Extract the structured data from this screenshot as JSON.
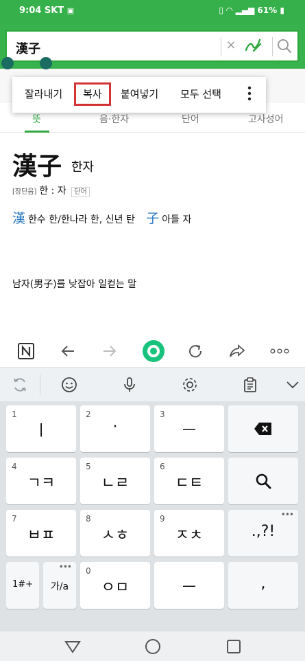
{
  "status": {
    "time": "9:04",
    "carrier": "SKT",
    "battery": "61%"
  },
  "search": {
    "value": "漢子",
    "clear_glyph": "×"
  },
  "context_menu": {
    "items": [
      "잘라내기",
      "복사",
      "붙여넣기",
      "모두 선택"
    ]
  },
  "tabs": [
    "뜻",
    "음·한자",
    "단어",
    "고사성어"
  ],
  "entry": {
    "headword": "漢子",
    "reading": "한자",
    "length_tag": "[장단음]",
    "syllables": "한 : 자",
    "type_tag": "단어",
    "char1": {
      "hanja": "漢",
      "meaning": "한수 한/한나라 한, 신년 탄"
    },
    "char2": {
      "hanja": "子",
      "meaning": "아들 자"
    },
    "definition": "남자(男子)를 낮잡아 일컫는 말"
  },
  "keyboard": {
    "rows": [
      [
        {
          "num": "1",
          "label": "ㅣ"
        },
        {
          "num": "2",
          "label": "·"
        },
        {
          "num": "3",
          "label": "ㅡ"
        },
        {
          "num": "",
          "label": ""
        }
      ],
      [
        {
          "num": "4",
          "label": "ㄱㅋ"
        },
        {
          "num": "5",
          "label": "ㄴㄹ"
        },
        {
          "num": "6",
          "label": "ㄷㅌ"
        },
        {
          "num": "",
          "label": ""
        }
      ],
      [
        {
          "num": "7",
          "label": "ㅂㅍ"
        },
        {
          "num": "8",
          "label": "ㅅㅎ"
        },
        {
          "num": "9",
          "label": "ㅈㅊ"
        },
        {
          "num": "",
          "label": ".,?!"
        }
      ],
      [
        {
          "num": "",
          "label": "1#+"
        },
        {
          "num": "",
          "label": "가/a"
        },
        {
          "num": "0",
          "label": "ㅇㅁ"
        },
        {
          "num": "",
          "label": "ㅡ"
        },
        {
          "num": "",
          "label": ","
        }
      ]
    ]
  },
  "colors": {
    "accent": "#2fa83f",
    "highlight_border": "#d43333",
    "hanja_blue": "#2b79c2"
  },
  "icons": {
    "naver": "naver-icon",
    "back": "back-arrow-icon",
    "forward": "forward-arrow-icon",
    "home": "green-dot-icon",
    "refresh": "refresh-icon",
    "share": "share-icon",
    "more": "more-dots-icon"
  }
}
